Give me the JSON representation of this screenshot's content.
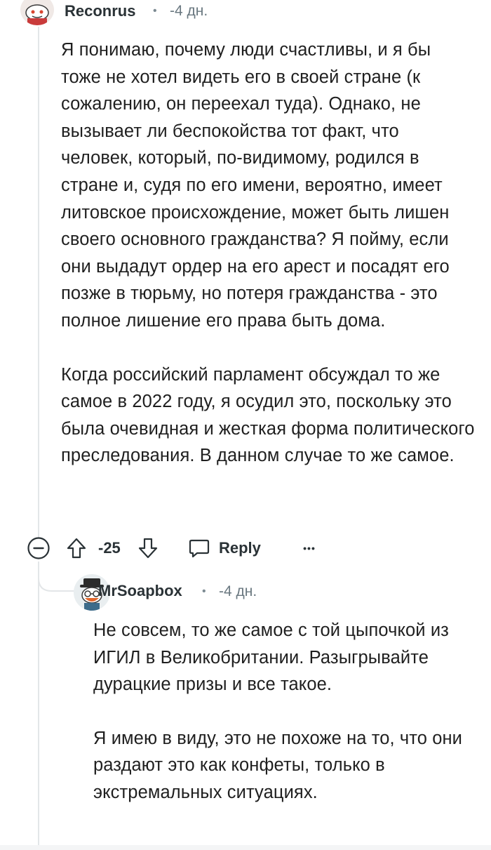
{
  "comments": [
    {
      "username": "Reconrus",
      "dot": "•",
      "time": "-4 дн.",
      "paragraphs": [
        "Я понимаю, почему люди счастливы, и я бы тоже не хотел видеть его в своей стране (к сожалению, он переехал туда). Однако, не вызывает ли беспокойства тот факт, что человек, который, по-видимому, родился в стране и, судя по его имени, вероятно, имеет литовское происхождение, может быть лишен своего основного гражданства? Я пойму, если они выдадут ордер на его арест и посадят его позже в тюрьму, но потеря гражданства - это полное лишение его права быть дома.",
        "Когда российский парламент обсуждал то же самое в 2022 году, я осудил это, поскольку это была очевидная и жесткая форма политического преследования. В данном случае то же самое."
      ],
      "actions": {
        "score": "-25",
        "reply_label": "Reply",
        "more_label": "•••"
      }
    },
    {
      "username": "MrSoapbox",
      "dot": "•",
      "time": "-4 дн.",
      "paragraphs": [
        "Не совсем, то же самое с той цыпочкой из ИГИЛ в Великобритании. Разыгрывайте дурацкие призы и все такое.",
        "Я имею в виду, это не похоже на то, что они раздают это как конфеты, только в экстремальных ситуациях."
      ]
    }
  ],
  "icons": {
    "collapse": "collapse-minus-icon",
    "upvote": "upvote-arrow-icon",
    "downvote": "downvote-arrow-icon",
    "reply": "reply-bubble-icon",
    "more": "more-options-icon"
  },
  "colors": {
    "text": "#1f1f1f",
    "meta": "#6a7880",
    "thread_line": "#e3e6e8"
  }
}
